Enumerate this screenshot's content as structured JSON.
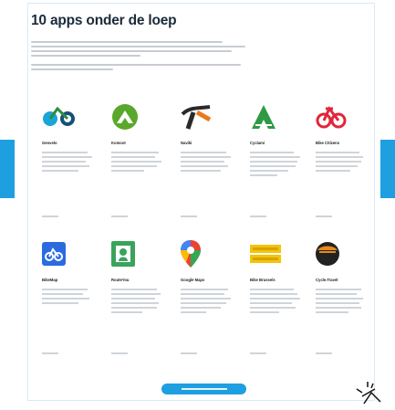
{
  "page": {
    "title": "10 apps onder de loep"
  },
  "apps": [
    {
      "name": "Geovelo",
      "icon": "geovelo-bike-icon",
      "color": "#1aa4d8"
    },
    {
      "name": "Komoot",
      "icon": "komoot-mountain-icon",
      "color": "#5aa82b"
    },
    {
      "name": "Naviki",
      "icon": "naviki-route-icon",
      "color": "#e87a1e"
    },
    {
      "name": "Cyclami",
      "icon": "cyclami-mountain-icon",
      "color": "#2e9a44"
    },
    {
      "name": "Bike Citizens",
      "icon": "bike-citizens-icon",
      "color": "#e0263a"
    },
    {
      "name": "BikeMap",
      "icon": "bikemap-icon",
      "color": "#2a6be0"
    },
    {
      "name": "RouteYou",
      "icon": "routeyou-icon",
      "color": "#3aa35c"
    },
    {
      "name": "Google Maps",
      "icon": "google-maps-pin-icon",
      "color": "#ea4335"
    },
    {
      "name": "Bike Brussels",
      "icon": "bike-brussels-icon",
      "color": "#f2c40b"
    },
    {
      "name": "Cycle.Travel",
      "icon": "cycle-travel-icon",
      "color": "#e8891a"
    }
  ],
  "colors": {
    "accent": "#1e9fe0",
    "text": "#1b2a3a",
    "placeholder": "#cfd4d9"
  }
}
